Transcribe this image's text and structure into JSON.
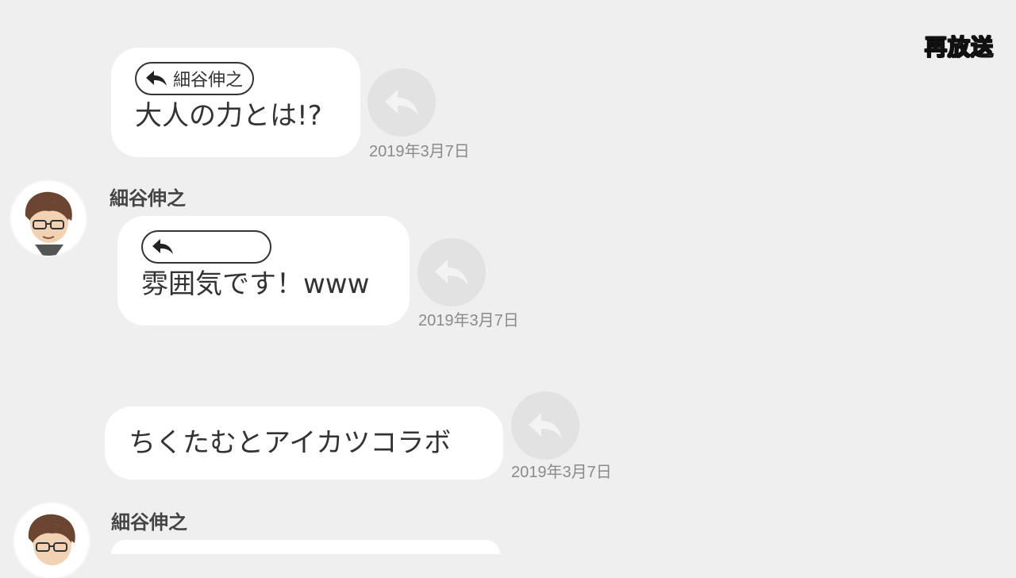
{
  "header": {
    "rebroadcast_label": "再放送"
  },
  "messages": [
    {
      "reply_to": "細谷伸之",
      "text": "大人の力とは!?",
      "timestamp": "2019年3月7日"
    },
    {
      "sender": "細谷伸之",
      "reply_to": "",
      "text": "雰囲気です！www",
      "timestamp": "2019年3月7日"
    },
    {
      "text": "ちくたむとアイカツコラボ",
      "timestamp": "2019年3月7日"
    },
    {
      "sender": "細谷伸之"
    }
  ],
  "icons": {
    "reply": "reply-arrow-icon",
    "avatar": "avatar-icon"
  },
  "colors": {
    "background": "#efefef",
    "bubble": "#ffffff",
    "reply_button": "#e2e2e2",
    "timestamp": "#8a8a8a"
  }
}
